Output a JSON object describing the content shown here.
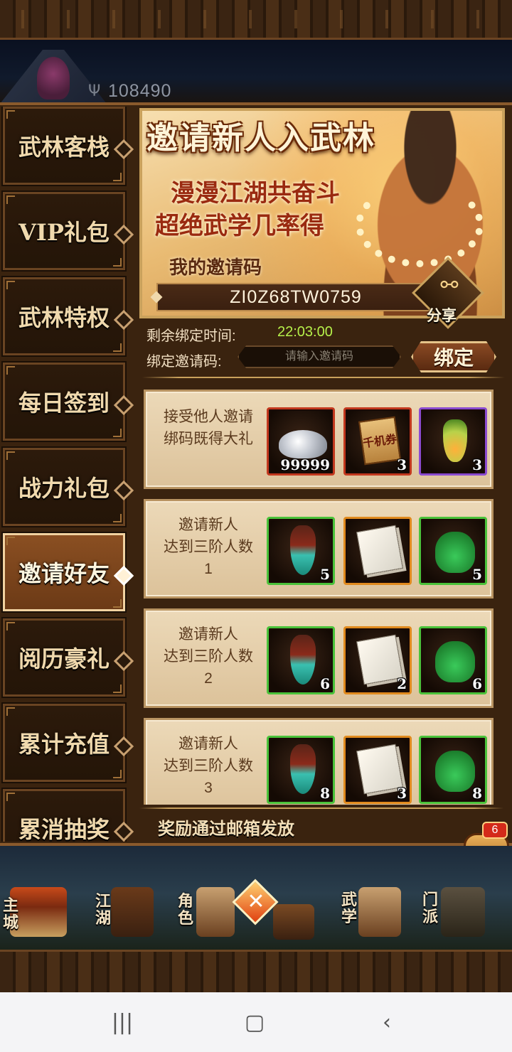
{
  "header": {
    "power_icon": "trident-icon",
    "power_value": "108490"
  },
  "sidebar": {
    "items": [
      {
        "label": "武林客栈",
        "active": false
      },
      {
        "label": "VIP礼包",
        "active": false
      },
      {
        "label": "武林特权",
        "active": false
      },
      {
        "label": "每日签到",
        "active": false
      },
      {
        "label": "战力礼包",
        "active": false
      },
      {
        "label": "邀请好友",
        "active": true
      },
      {
        "label": "阅历豪礼",
        "active": false
      },
      {
        "label": "累计充值",
        "active": false
      },
      {
        "label": "累消抽奖",
        "active": false
      }
    ]
  },
  "banner": {
    "title": "邀请新人入武林",
    "line1": "漫漫江湖共奋斗",
    "line2": "超绝武学几率得",
    "code_label": "我的邀请码",
    "code_value": "ZI0Z68TW0759",
    "share_label": "分享",
    "share_icon": "share-nodes-icon"
  },
  "binding": {
    "remain_label": "剩余绑定时间:",
    "remain_time": "22:03:00",
    "bind_label": "绑定邀请码:",
    "input_placeholder": "请输入邀请码",
    "bind_button": "绑定"
  },
  "rewards": [
    {
      "line1": "接受他人邀请",
      "line2": "绑码既得大礼",
      "line3": "",
      "items": [
        {
          "icon": "silver-pile-icon",
          "count": "99999",
          "frame": "red"
        },
        {
          "icon": "scroll-ticket-icon",
          "count": "3",
          "frame": "red",
          "art_text": "千机券"
        },
        {
          "icon": "elixir-flask-icon",
          "count": "3",
          "frame": "purple"
        }
      ]
    },
    {
      "line1": "邀请新人",
      "line2": "达到三阶人数",
      "line3": "1",
      "items": [
        {
          "icon": "jade-gourd-icon",
          "count": "5",
          "frame": "green"
        },
        {
          "icon": "manual-pages-icon",
          "count": "",
          "frame": "orange"
        },
        {
          "icon": "green-pouch-icon",
          "count": "5",
          "frame": "green"
        }
      ]
    },
    {
      "line1": "邀请新人",
      "line2": "达到三阶人数",
      "line3": "2",
      "items": [
        {
          "icon": "jade-gourd-icon",
          "count": "6",
          "frame": "green"
        },
        {
          "icon": "manual-pages-icon",
          "count": "2",
          "frame": "orange"
        },
        {
          "icon": "green-pouch-icon",
          "count": "6",
          "frame": "green"
        }
      ]
    },
    {
      "line1": "邀请新人",
      "line2": "达到三阶人数",
      "line3": "3",
      "items": [
        {
          "icon": "jade-gourd-icon",
          "count": "8",
          "frame": "green"
        },
        {
          "icon": "manual-pages-icon",
          "count": "3",
          "frame": "orange"
        },
        {
          "icon": "green-pouch-icon",
          "count": "8",
          "frame": "green"
        }
      ]
    }
  ],
  "footer_note": "奖励通过邮箱发放",
  "chat": {
    "icon": "chat-bubble-icon",
    "badge": "6"
  },
  "bottom_nav": [
    {
      "label": "主城",
      "icon": "palace-icon"
    },
    {
      "label": "江湖",
      "icon": "banner-flag-icon"
    },
    {
      "label": "角色",
      "icon": "scroll-bag-icon"
    },
    {
      "label": "",
      "icon": "crossed-swords-icon"
    },
    {
      "label": "武学",
      "icon": "book-scroll-icon"
    },
    {
      "label": "门派",
      "icon": "bronze-cauldron-icon"
    }
  ],
  "system_nav": [
    {
      "icon": "recent-apps-icon",
      "glyph": "|||"
    },
    {
      "icon": "home-icon",
      "glyph": "▢"
    },
    {
      "icon": "back-icon",
      "glyph": "‹"
    }
  ],
  "colors": {
    "panel_bg": "#3a230f",
    "accent_gold": "#c9a15c",
    "timer_green": "#b6f04a",
    "active_tab": "#8a4f22"
  }
}
